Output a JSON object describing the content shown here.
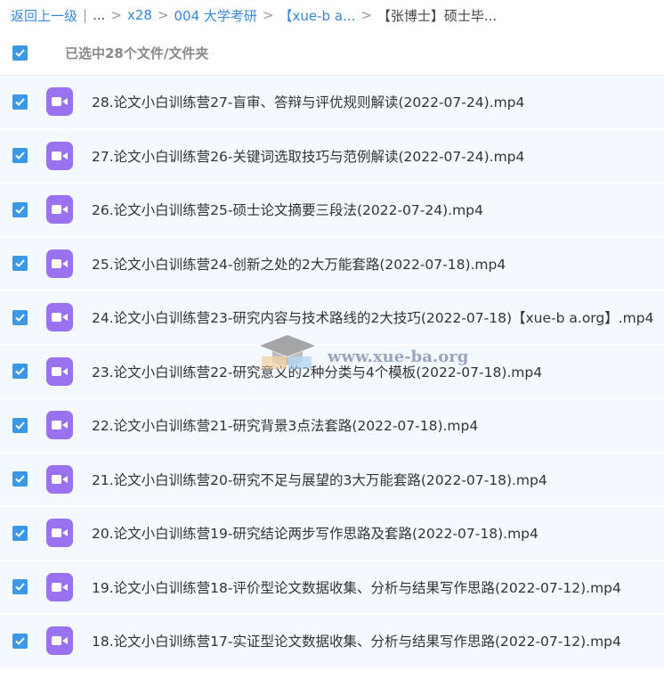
{
  "breadcrumb": {
    "back": "返回上一级",
    "sep1": "|",
    "ellipsis": "...",
    "items": [
      "x28",
      "004 大学考研",
      "【xue-b a...",
      "【张博士】硕士毕..."
    ],
    "arrow": ">"
  },
  "selection": {
    "label": "已选中28个文件/文件夹",
    "checked": true
  },
  "files": [
    {
      "name": "28.论文小白训练营27-盲审、答辩与评优规则解读(2022-07-24).mp4",
      "checked": true,
      "icon": "video-file-icon"
    },
    {
      "name": "27.论文小白训练营26-关键词选取技巧与范例解读(2022-07-24).mp4",
      "checked": true,
      "icon": "video-file-icon"
    },
    {
      "name": "26.论文小白训练营25-硕士论文摘要三段法(2022-07-24).mp4",
      "checked": true,
      "icon": "video-file-icon"
    },
    {
      "name": "25.论文小白训练营24-创新之处的2大万能套路(2022-07-18).mp4",
      "checked": true,
      "icon": "video-file-icon"
    },
    {
      "name": "24.论文小白训练营23-研究内容与技术路线的2大技巧(2022-07-18)【xue-b a.org】.mp4",
      "checked": true,
      "icon": "video-file-icon"
    },
    {
      "name": "23.论文小白训练营22-研究意义的2种分类与4个模板(2022-07-18).mp4",
      "checked": true,
      "icon": "video-file-icon"
    },
    {
      "name": "22.论文小白训练营21-研究背景3点法套路(2022-07-18).mp4",
      "checked": true,
      "icon": "video-file-icon"
    },
    {
      "name": "21.论文小白训练营20-研究不足与展望的3大万能套路(2022-07-18).mp4",
      "checked": true,
      "icon": "video-file-icon"
    },
    {
      "name": "20.论文小白训练营19-研究结论两步写作思路及套路(2022-07-18).mp4",
      "checked": true,
      "icon": "video-file-icon"
    },
    {
      "name": "19.论文小白训练营18-评价型论文数据收集、分析与结果写作思路(2022-07-12).mp4",
      "checked": true,
      "icon": "video-file-icon"
    },
    {
      "name": "18.论文小白训练营17-实证型论文数据收集、分析与结果写作思路(2022-07-12).mp4",
      "checked": true,
      "icon": "video-file-icon"
    }
  ],
  "watermark": {
    "text": "www.xue-ba.org"
  },
  "colors": {
    "link": "#3a86d8",
    "checkbox": "#3b98e4",
    "video_icon": "#9a71ee",
    "row_bg": "#f3f9ff"
  }
}
